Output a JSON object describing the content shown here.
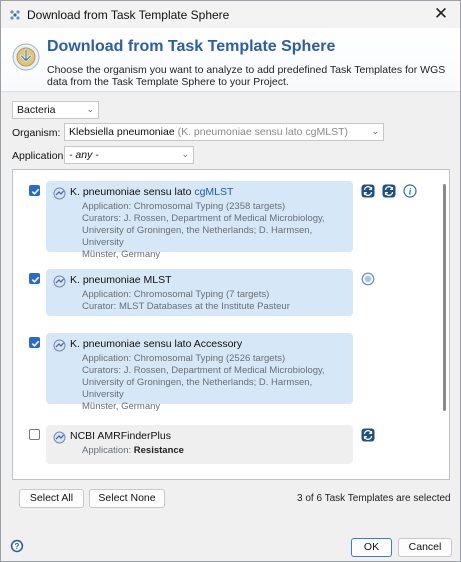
{
  "window": {
    "title": "Download from Task Template Sphere"
  },
  "header": {
    "title": "Download from Task Template Sphere",
    "description": "Choose the organism you want to analyze to add predefined Task Templates for WGS data from the Task Template Sphere to your Project."
  },
  "filters": {
    "category": "Bacteria",
    "organism_label": "Organism:",
    "organism_value": "Klebsiella pneumoniae",
    "organism_hint": "(K. pneumoniae sensu lato cgMLST)",
    "application_label": "Application:",
    "application_value": "- any -"
  },
  "templates": [
    {
      "checked": true,
      "title_prefix": "K. pneumoniae sensu lato ",
      "title_highlight": "cgMLST",
      "lines": [
        "Application: Chromosomal Typing (2358 targets)",
        "Curators: J. Rossen, Department of Medical Microbiology,",
        "University of Groningen, the Netherlands; D. Harmsen, University",
        "Münster, Germany"
      ],
      "side_icons": [
        "sync-icon",
        "sync-icon",
        "info-icon"
      ]
    },
    {
      "checked": true,
      "title_prefix": "K. pneumoniae MLST",
      "title_highlight": "",
      "lines": [
        "Application: Chromosomal Typing (7 targets)",
        "Curator: MLST Databases at the Institute Pasteur"
      ],
      "side_icons": [
        "globe-icon"
      ]
    },
    {
      "checked": true,
      "title_prefix": "K. pneumoniae sensu lato Accessory",
      "title_highlight": "",
      "lines": [
        "Application: Chromosomal Typing (2526 targets)",
        "Curators: J. Rossen, Department of Medical Microbiology,",
        "University of Groningen, the Netherlands; D. Harmsen, University",
        "Münster, Germany"
      ],
      "side_icons": []
    },
    {
      "checked": false,
      "title_prefix": "NCBI AMRFinderPlus",
      "title_highlight": "",
      "application_prefix": "Application: ",
      "application_bold": "Resistance",
      "side_icons": [
        "sync-icon"
      ]
    }
  ],
  "footer": {
    "select_all": "Select All",
    "select_none": "Select None",
    "status": "3 of 6 Task Templates are selected",
    "ok": "OK",
    "cancel": "Cancel"
  },
  "colors": {
    "accent": "#2b5ea8",
    "card_selected": "#d6e7f8",
    "card_unselected": "#efefef",
    "checkbox": "#2a6bc4"
  }
}
